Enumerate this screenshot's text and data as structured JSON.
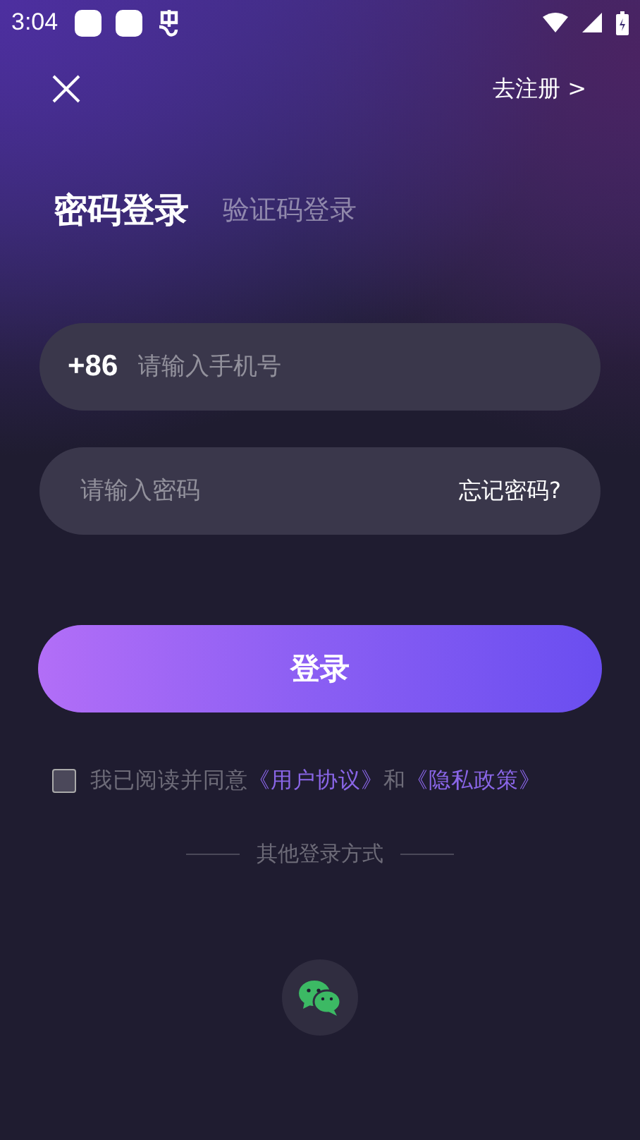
{
  "status_bar": {
    "time": "3:04"
  },
  "header": {
    "register_link": "去注册 >"
  },
  "tabs": [
    {
      "label": "密码登录",
      "selected": true
    },
    {
      "label": "验证码登录",
      "selected": false
    }
  ],
  "phone_field": {
    "country_code": "+86",
    "placeholder": "请输入手机号"
  },
  "password_field": {
    "placeholder": "请输入密码",
    "forgot_link": "忘记密码?"
  },
  "login_button": "登录",
  "agreement": {
    "checked": false,
    "segments": [
      {
        "kind": "text",
        "text": "我已阅读并同意"
      },
      {
        "kind": "link",
        "text": "《用户协议》"
      },
      {
        "kind": "text",
        "text": "和"
      },
      {
        "kind": "link",
        "text": "《隐私政策》"
      }
    ]
  },
  "other_login": {
    "label": "其他登录方式"
  }
}
